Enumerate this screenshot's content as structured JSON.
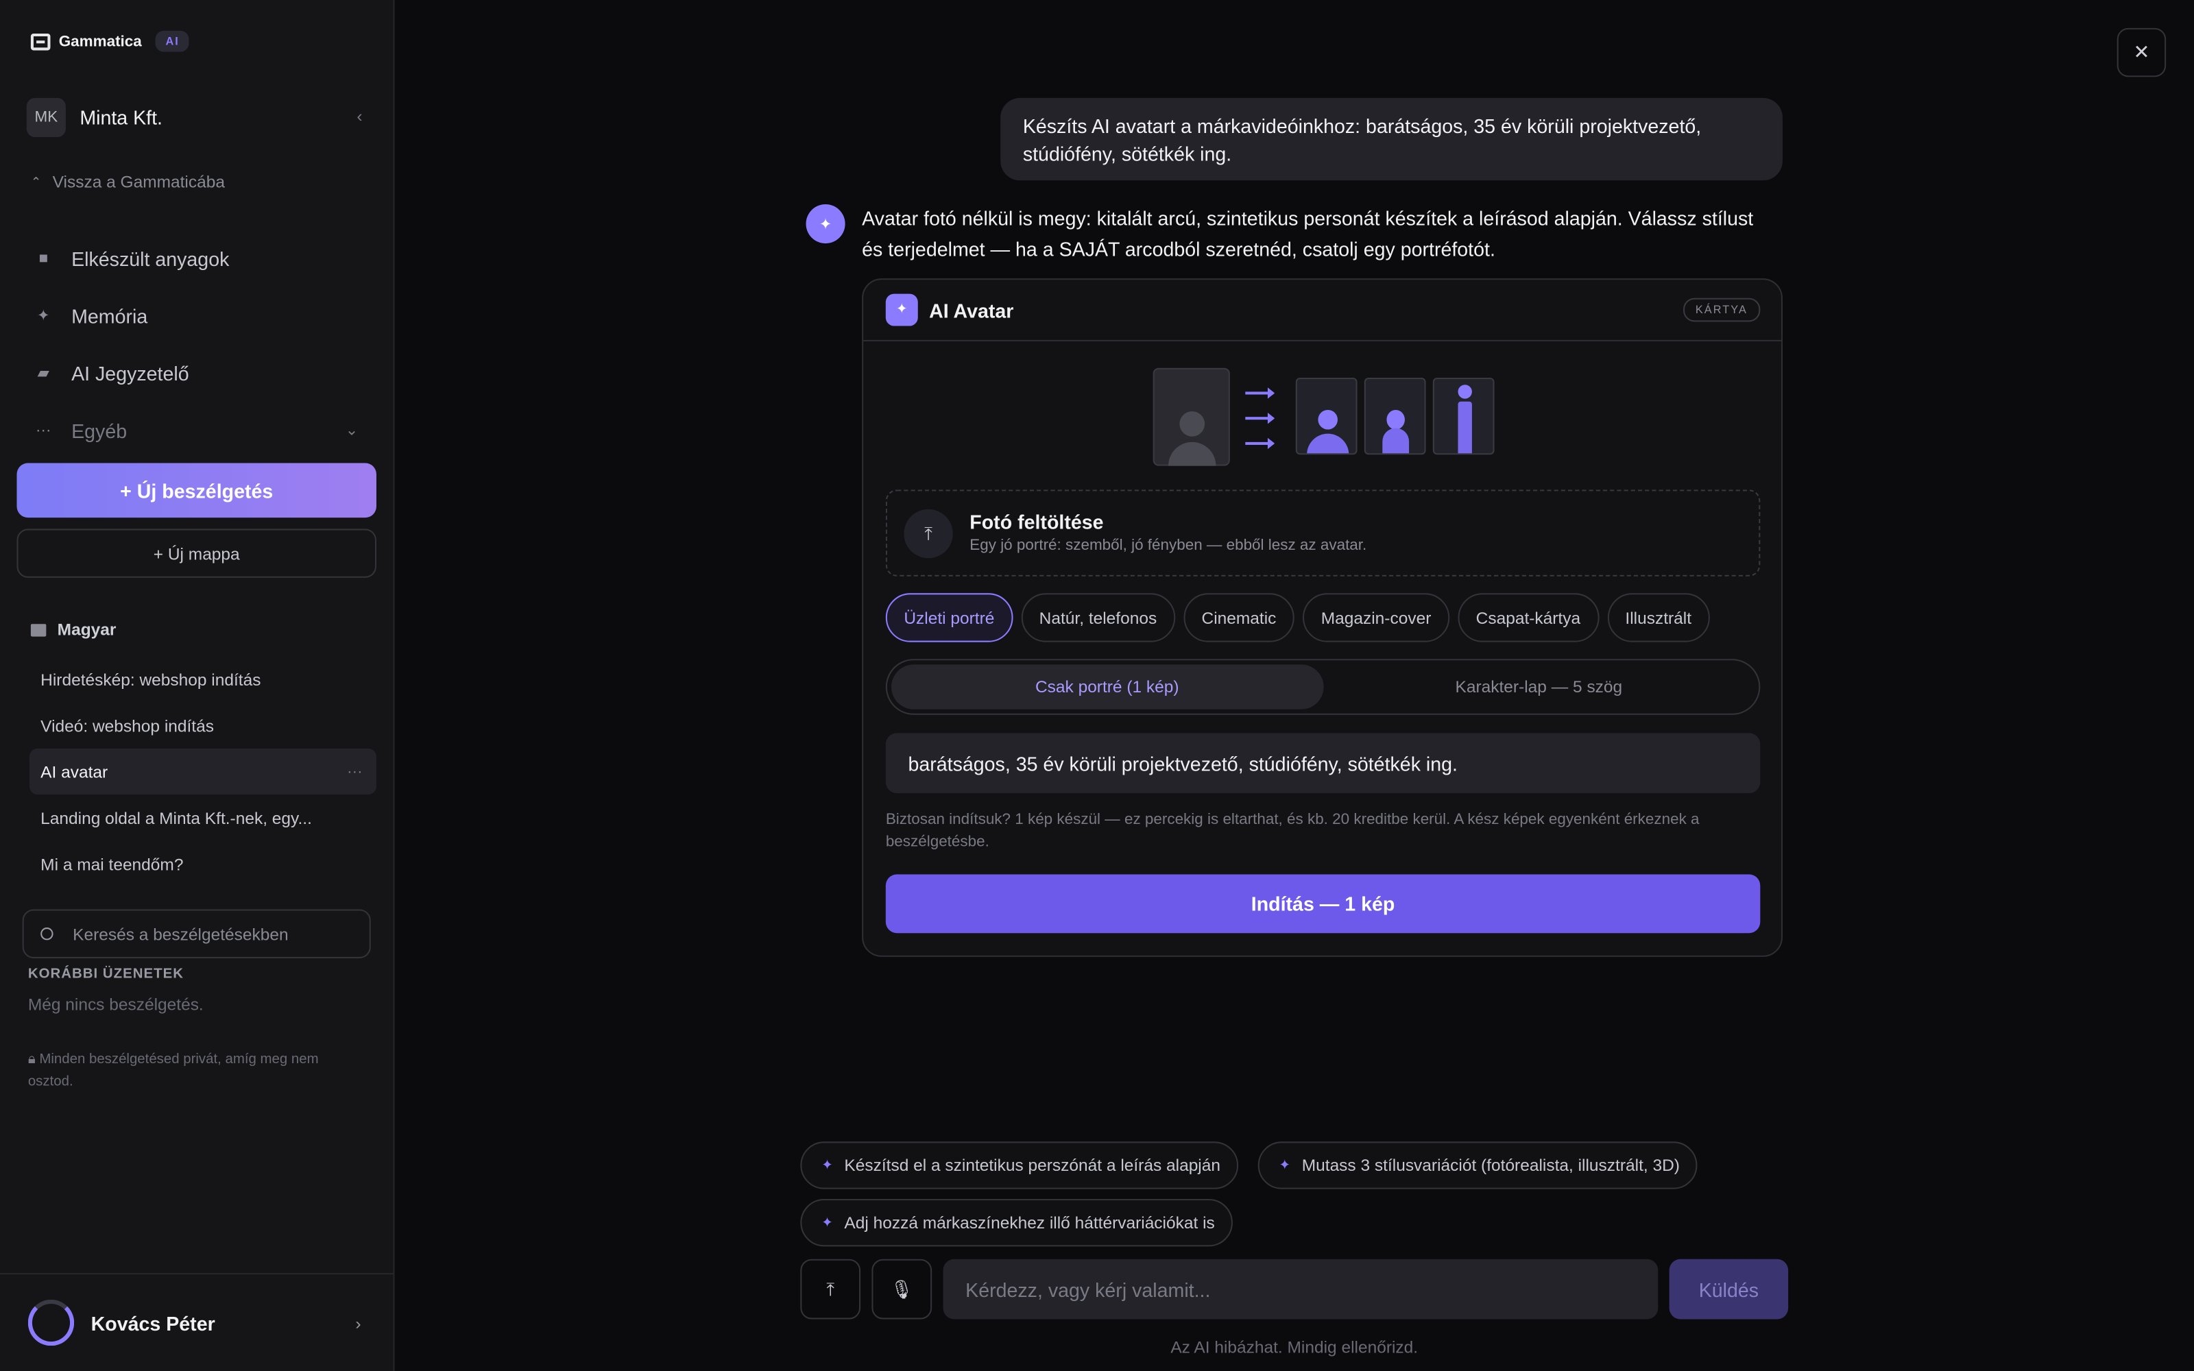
{
  "brand": {
    "name": "Gammatica",
    "badge": "AI"
  },
  "org": {
    "initials": "MK",
    "name": "Minta Kft."
  },
  "sidebar": {
    "back": "Vissza a Gammaticába",
    "nav": [
      {
        "label": "Elkészült anyagok",
        "icon": "folder-icon"
      },
      {
        "label": "Memória",
        "icon": "sparkle-icon"
      },
      {
        "label": "AI Jegyzetelő",
        "icon": "video-icon"
      },
      {
        "label": "Egyéb",
        "icon": "more-icon"
      }
    ],
    "new_chat": "+ Új beszélgetés",
    "new_folder": "+ Új mappa",
    "folder": "Magyar",
    "conversations": [
      "Hirdetéskép: webshop indítás",
      "Videó: webshop indítás",
      "AI avatar",
      "Landing oldal a Minta Kft.-nek, egy...",
      "Mi a mai teendőm?"
    ],
    "search_placeholder": "Keresés a beszélgetésekben",
    "previous_label": "KORÁBBI ÜZENETEK",
    "previous_empty": "Még nincs beszélgetés.",
    "privacy": "Minden beszélgetésed privát, amíg meg nem osztod."
  },
  "user": {
    "name": "Kovács Péter"
  },
  "chat": {
    "user_message": "Készíts AI avatart a márkavideóinkhoz: barátságos, 35 év körüli projektvezető, stúdiófény, sötétkék ing.",
    "bot_message": "Avatar fotó nélkül is megy: kitalált arcú, szintetikus personát készítek a leírásod alapján. Válassz stílust és terjedelmet — ha a SAJÁT arcodból szeretnéd, csatolj egy portréfotót."
  },
  "card": {
    "title": "AI Avatar",
    "tag": "KÁRTYA",
    "upload_title": "Fotó feltöltése",
    "upload_sub": "Egy jó portré: szemből, jó fényben — ebből lesz az avatar.",
    "styles": [
      "Üzleti portré",
      "Natúr, telefonos",
      "Cinematic",
      "Magazin-cover",
      "Csapat-kártya",
      "Illusztrált"
    ],
    "selected_style": "Üzleti portré",
    "scope_options": [
      "Csak portré (1 kép)",
      "Karakter-lap — 5 szög"
    ],
    "selected_scope": "Csak portré (1 kép)",
    "prompt": "barátságos, 35 év körüli projektvezető, stúdiófény, sötétkék ing.",
    "confirm": "Biztosan indítsuk? 1 kép készül — ez percekig is eltarthat, és kb. 20 kreditbe kerül. A kész képek egyenként érkeznek a beszélgetésbe.",
    "start": "Indítás — 1 kép"
  },
  "suggestions": [
    "Készítsd el a szintetikus perszónát a leírás alapján",
    "Mutass 3 stílusvariációt (fotórealista, illusztrált, 3D)",
    "Adj hozzá márkaszínekhez illő háttérvariációkat is"
  ],
  "composer": {
    "placeholder": "Kérdezz, vagy kérj valamit...",
    "send": "Küldés",
    "disclaimer": "Az AI hibázhat. Mindig ellenőrizd."
  },
  "colors": {
    "accent": "#8b7bff",
    "button": "#6d59ea",
    "bg": "#0b0b0d",
    "sidebar": "#151518"
  }
}
